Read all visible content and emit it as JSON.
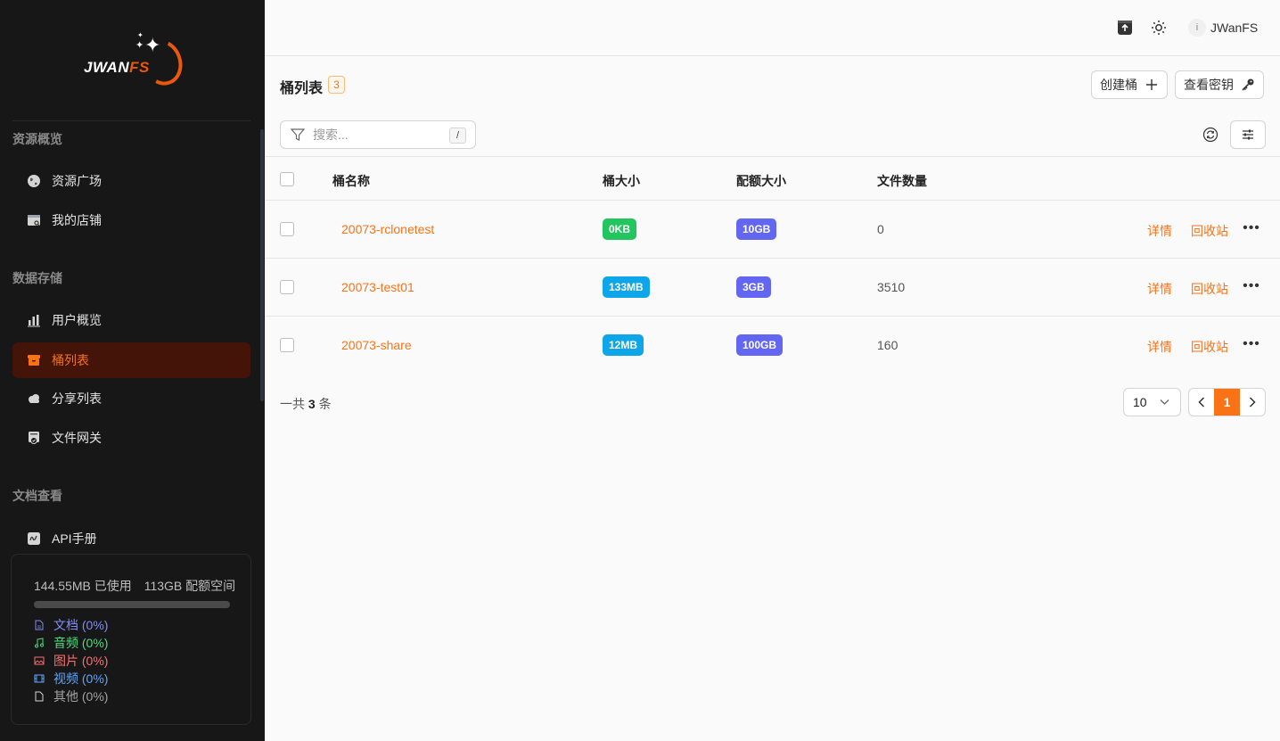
{
  "brand": {
    "logo_main": "JWAN",
    "logo_accent": "FS"
  },
  "colors": {
    "accent": "#f97316",
    "sidebar_bg": "#171717",
    "active_bg": "#431407"
  },
  "sidebar": {
    "sections": [
      {
        "title": "资源概览",
        "items": [
          {
            "label": "资源广场",
            "icon": "globe-icon"
          },
          {
            "label": "我的店铺",
            "icon": "store-icon"
          }
        ]
      },
      {
        "title": "数据存储",
        "items": [
          {
            "label": "用户概览",
            "icon": "bar-chart-icon"
          },
          {
            "label": "桶列表",
            "icon": "archive-icon",
            "active": true
          },
          {
            "label": "分享列表",
            "icon": "cloud-icon"
          },
          {
            "label": "文件网关",
            "icon": "gateway-icon"
          }
        ]
      },
      {
        "title": "文档查看",
        "items": [
          {
            "label": "API手册",
            "icon": "api-icon"
          }
        ]
      }
    ],
    "storage": {
      "used": "144.55MB 已使用",
      "quota": "113GB 配额空间",
      "used_fraction": 0,
      "legend": [
        {
          "label": "文档 (0%)",
          "color": "#818cf8",
          "icon": "document-icon"
        },
        {
          "label": "音频 (0%)",
          "color": "#4ade80",
          "icon": "music-icon"
        },
        {
          "label": "图片 (0%)",
          "color": "#f87171",
          "icon": "image-icon"
        },
        {
          "label": "视频 (0%)",
          "color": "#60a5fa",
          "icon": "film-icon"
        },
        {
          "label": "其他 (0%)",
          "color": "#a3a3a3",
          "icon": "file-icon"
        }
      ]
    }
  },
  "topbar": {
    "user_initial": "i",
    "username": "JWanFS"
  },
  "main": {
    "title": "桶列表",
    "count": "3",
    "create_button": "创建桶",
    "keys_button": "查看密钥",
    "search": {
      "placeholder": "搜索...",
      "value": "",
      "shortcut": "/"
    },
    "table": {
      "headers": [
        "桶名称",
        "桶大小",
        "配额大小",
        "文件数量"
      ],
      "rows": [
        {
          "name": "20073-rclonetest",
          "size": "0KB",
          "quota": "10GB",
          "files": "0",
          "size_color": "#22c55e"
        },
        {
          "name": "20073-test01",
          "size": "133MB",
          "quota": "3GB",
          "files": "3510",
          "size_color": "#0ea5e9"
        },
        {
          "name": "20073-share",
          "size": "12MB",
          "quota": "100GB",
          "files": "160",
          "size_color": "#0ea5e9"
        }
      ],
      "actions": {
        "detail": "详情",
        "recycle": "回收站"
      }
    },
    "footer": {
      "total_prefix": "一共",
      "total_count": "3",
      "total_suffix": "条",
      "page_size": "10",
      "current_page": "1"
    }
  }
}
